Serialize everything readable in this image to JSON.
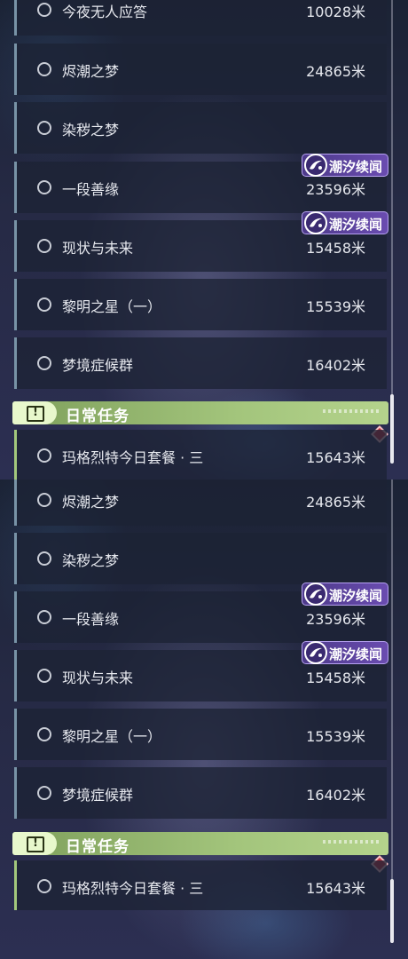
{
  "top_panel": {
    "quests": [
      {
        "name": "今夜无人应答",
        "distance": "10028米"
      },
      {
        "name": "烬潮之梦",
        "distance": "24865米"
      },
      {
        "name": "染秽之梦",
        "distance": ""
      },
      {
        "name": "一段善缘",
        "distance": "23596米"
      },
      {
        "name": "现状与未来",
        "distance": "15458米"
      },
      {
        "name": "黎明之星（一）",
        "distance": "15539米"
      },
      {
        "name": "梦境症候群",
        "distance": "16402米"
      }
    ],
    "tags": [
      {
        "label": "潮汐续闻"
      },
      {
        "label": "潮汐续闻"
      }
    ],
    "section": {
      "title": "日常任务",
      "alert_symbol": "!"
    },
    "daily_quest": {
      "name": "玛格烈特今日套餐 · 三",
      "distance": "15643米"
    }
  },
  "bottom_panel": {
    "quests": [
      {
        "name": "烬潮之梦",
        "distance": "24865米"
      },
      {
        "name": "染秽之梦",
        "distance": ""
      },
      {
        "name": "一段善缘",
        "distance": "23596米"
      },
      {
        "name": "现状与未来",
        "distance": "15458米"
      },
      {
        "name": "黎明之星（一）",
        "distance": "15539米"
      },
      {
        "name": "梦境症候群",
        "distance": "16402米"
      }
    ],
    "tags": [
      {
        "label": "潮汐续闻"
      },
      {
        "label": "潮汐续闻"
      }
    ],
    "section": {
      "title": "日常任务",
      "alert_symbol": "!"
    },
    "daily_quest": {
      "name": "玛格烈特今日套餐 · 三",
      "distance": "15643米"
    }
  },
  "icons": {
    "tag_icon": "tide-swirl-icon",
    "radio_icon": "radio-circle-icon",
    "alert_icon": "alert-box-icon",
    "marker_icon": "red-diamond-icon"
  },
  "colors": {
    "quest_accent": "#7893a6",
    "daily_accent": "#a3c87c",
    "tag_purple": "#6a4cb0",
    "marker_red": "#c8343f"
  }
}
